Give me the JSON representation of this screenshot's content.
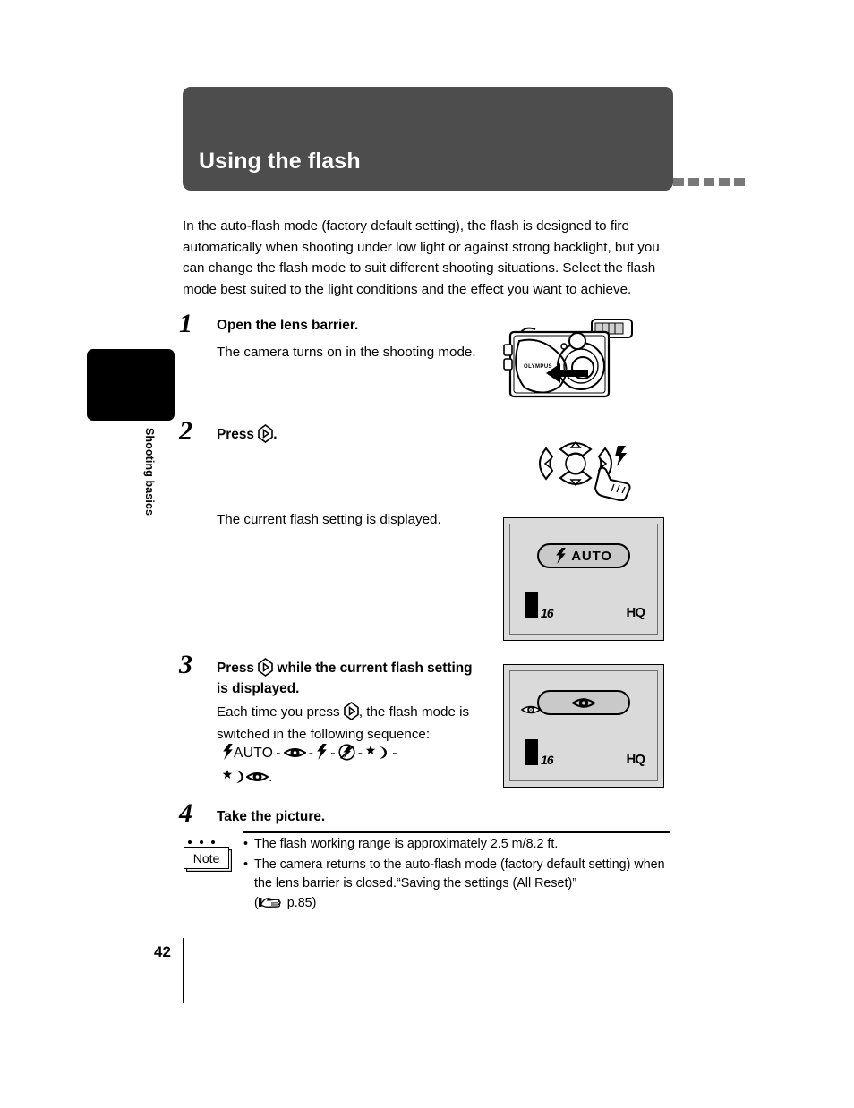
{
  "page": {
    "number": "42",
    "side_tab_label": "Shooting basics"
  },
  "header": {
    "title": "Using the flash",
    "bar_color": "#4d4d4d",
    "dash_color": "#787878",
    "dash_count": 5
  },
  "intro": "In the auto-flash mode (factory default setting), the flash is designed to fire automatically when shooting under low light or against strong backlight, but you can change the flash mode to suit different shooting situations. Select the flash mode best suited to the light conditions and the effect you want to achieve.",
  "steps": [
    {
      "number": "1",
      "heading": "Open the lens barrier.",
      "body": "The camera turns on in the shooting mode."
    },
    {
      "number": "2",
      "heading_before": "Press",
      "heading_after": ".",
      "body": "The current flash setting is displayed."
    },
    {
      "number": "3",
      "heading_before": "Press",
      "heading_after": "while the current flash setting is displayed.",
      "body_before": "Each time you press",
      "body_after": ", the flash mode is switched in the following sequence:",
      "sequence_label": "AUTO",
      "sequence_end": "."
    },
    {
      "number": "4",
      "heading": "Take the picture."
    }
  ],
  "camera_figure": {
    "brand": "OLYMPUS",
    "icon": "camera-front-with-lens-barrier"
  },
  "arrowpad_figure": {
    "icon": "four-way-arrow-pad-with-finger",
    "flash_symbol": "flash-bolt-icon"
  },
  "lcd_auto": {
    "mode_text": "AUTO",
    "mode_icon": "flash-bolt-icon",
    "frame_count": "16",
    "quality": "HQ",
    "battery_icon": "battery-full-icon",
    "bg_color": "#dadada"
  },
  "lcd_redeye": {
    "mode_icon": "red-eye-reduction-icon",
    "corner_icon": "red-eye-reduction-small-icon",
    "frame_count": "16",
    "quality": "HQ",
    "battery_icon": "battery-full-icon",
    "bg_color": "#dadada"
  },
  "note": {
    "label": "Note",
    "bullet": "•",
    "items": [
      "The flash working range is approximately 2.5 m/8.2 ft.",
      "The camera returns to the auto-flash mode (factory default setting) when the lens barrier is closed.“Saving the settings (All Reset)”"
    ],
    "reference_open": "(",
    "reference_page": "p.85",
    "reference_close": ")",
    "reference_icon": "pointing-hand-icon"
  }
}
